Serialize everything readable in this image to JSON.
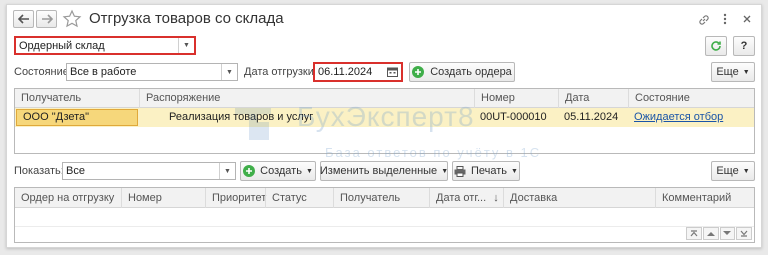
{
  "window": {
    "title": "Отгрузка товаров со склада",
    "back_icon": "arrow-left-icon",
    "forward_icon": "arrow-right-icon",
    "star_icon": "star-outline-icon",
    "link_icon": "link-icon",
    "menu_icon": "more-vertical-icon",
    "close_icon": "close-icon"
  },
  "warehouse": {
    "value": "Ордерный склад"
  },
  "toolbar_top": {
    "refresh_icon": "refresh-icon",
    "help_label": "?"
  },
  "filters": {
    "status_label": "Состояние:",
    "status_value": "Все в работе",
    "date_label": "Дата отгрузки:",
    "date_value": "06.11.2024",
    "create_orders_label": "Создать ордера",
    "more_label": "Еще"
  },
  "orders_table": {
    "columns": [
      "Получатель",
      "Распоряжение",
      "Номер",
      "Дата",
      "Состояние"
    ],
    "rows": [
      {
        "recipient": "ООО \"Дзета\"",
        "order": "Реализация товаров и услуг",
        "number": "00UT-000010",
        "date": "05.11.2024",
        "state": "Ожидается отбор"
      }
    ]
  },
  "bottom_toolbar": {
    "show_label": "Показать:",
    "show_value": "Все",
    "create_label": "Создать",
    "edit_selected_label": "Изменить выделенные",
    "print_label": "Печать",
    "more_label": "Еще"
  },
  "shipment_table": {
    "columns": [
      "Ордер на отгрузку",
      "Номер",
      "Приоритет",
      "Статус",
      "Получатель",
      "Дата отг...",
      "Доставка",
      "Комментарий"
    ],
    "sort_indicator": "↓"
  },
  "watermark": {
    "text": "БухЭксперт8",
    "subtitle": "База ответов по учёту в 1С"
  },
  "colors": {
    "highlight_red": "#d9302c",
    "selected_row": "#fbf1c4",
    "selected_cell": "#f6d77b",
    "green": "#3fae49",
    "link": "#1a55a8"
  }
}
